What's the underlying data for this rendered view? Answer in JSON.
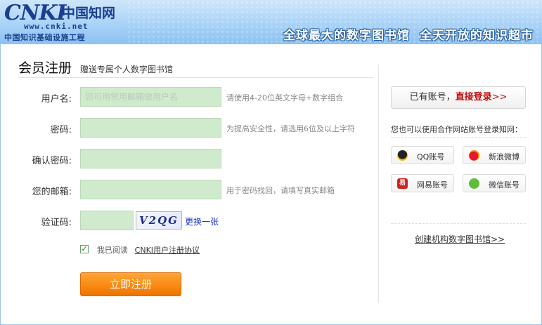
{
  "header": {
    "logo_mark": "CNKI",
    "logo_cn_name": "中国知网",
    "logo_url": "www.cnki.net",
    "logo_sub": "中国知识基础设施工程",
    "slogan_left": "全球最大的数字图书馆",
    "slogan_right": "全天开放的知识超市"
  },
  "page": {
    "title": "会员注册",
    "subtitle": "赠送专属个人数字图书馆"
  },
  "form": {
    "username": {
      "label": "用户名:",
      "placeholder": "您可用常用邮箱做用户名",
      "value": "",
      "hint": "请使用4-20位英文字母+数字组合"
    },
    "password": {
      "label": "密码:",
      "value": "",
      "hint": "为提高安全性，请选用6位及以上字符"
    },
    "confirm_password": {
      "label": "确认密码:",
      "value": ""
    },
    "email": {
      "label": "您的邮箱:",
      "value": "",
      "hint": "用于密码找回，请填写真实邮箱"
    },
    "captcha": {
      "label": "验证码:",
      "value": "",
      "image_text": "V2QG",
      "refresh_label": "更换一张"
    },
    "agree": {
      "checked": true,
      "text": "我已阅读",
      "link": "CNKI用户注册协议"
    },
    "submit_label": "立即注册"
  },
  "sidebar": {
    "login_prefix": "已有账号，",
    "login_link": "直接登录",
    "login_arrows": ">>",
    "partner_title": "您也可以使用合作网站账号登录知网：",
    "partners": [
      {
        "icon": "qq-icon",
        "label": "QQ账号"
      },
      {
        "icon": "weibo-icon",
        "label": "新浪微博"
      },
      {
        "icon": "netease-icon",
        "label": "网易账号"
      },
      {
        "icon": "wechat-icon",
        "label": "微信账号"
      }
    ],
    "org_link": "创建机构数字图书馆>>"
  },
  "colors": {
    "header_bg": "#a9d2f7",
    "input_bg": "#cfeacd",
    "submit_bg": "#f98a12",
    "login_accent": "#c30d0d",
    "link_blue": "#1d38c9"
  }
}
